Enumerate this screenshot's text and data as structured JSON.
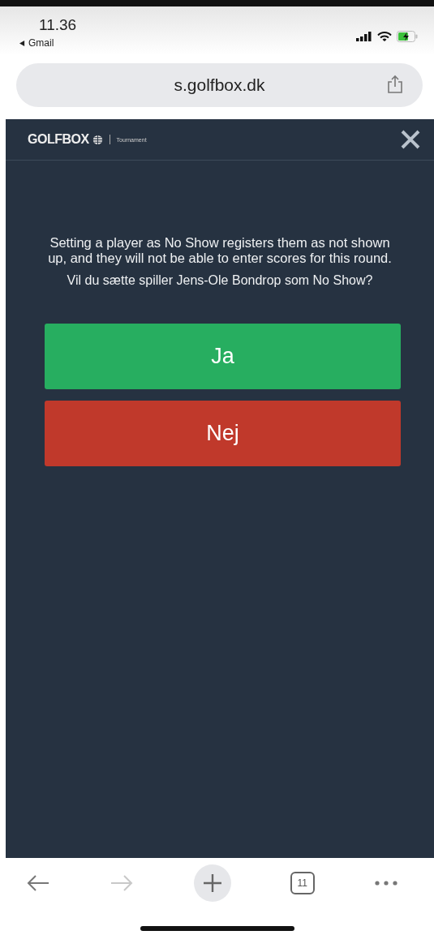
{
  "status_bar": {
    "time": "11.36",
    "back_app": "Gmail"
  },
  "address_bar": {
    "url": "s.golfbox.dk"
  },
  "header": {
    "logo": "GOLFBOX",
    "product": "Tournament"
  },
  "dialog": {
    "message": "Setting a player as No Show registers them as not shown up, and they will not be able to enter scores for this round.",
    "question": "Vil du sætte spiller Jens-Ole Bondrop som No Show?"
  },
  "buttons": [
    {
      "label": "Ja",
      "kind": "confirm"
    },
    {
      "label": "Nej",
      "kind": "cancel"
    }
  ],
  "toolbar": {
    "forward_disabled": true,
    "tab_count": "11"
  }
}
